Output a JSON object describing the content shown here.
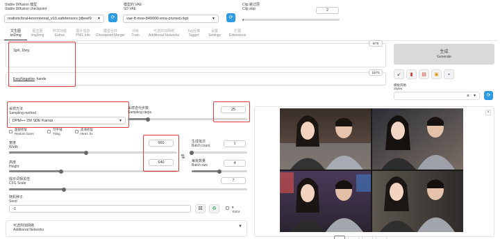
{
  "top": {
    "checkpoint_label_zh": "Stable Diffusion 模型",
    "checkpoint_label_en": "Stable Diffusion checkpoint",
    "checkpoint_value": "realistic/braHennmixreal_v10.safetensors [dbeef9",
    "vae_label_zh": "模型的 VAE",
    "vae_label_en": "SD VAE",
    "vae_value": "vae-ft-mse-840000-ema-pruned.ckpt",
    "clip_label_zh": "Clip 跳过层",
    "clip_label_en": "Clip skip",
    "clip_value": "2",
    "refresh_icon": "refresh-icon"
  },
  "tabs": [
    {
      "zh": "文生图",
      "en": "txt2img",
      "active": true
    },
    {
      "zh": "图生图",
      "en": "img2img"
    },
    {
      "zh": "附加功能",
      "en": "Extras"
    },
    {
      "zh": "图片信息",
      "en": "PNG Info"
    },
    {
      "zh": "模型合并",
      "en": "Checkpoint Merger"
    },
    {
      "zh": "训练",
      "en": "Train"
    },
    {
      "zh": "可选附加网络",
      "en": "Additional Networks"
    },
    {
      "zh": "Tag反推",
      "en": "Tagger"
    },
    {
      "zh": "设置",
      "en": "Settings"
    },
    {
      "zh": "扩展",
      "en": "Extensions"
    }
  ],
  "prompt": {
    "positive": "1girl, 1boy,",
    "positive_count": "6/75",
    "negative_prefix": "EasyNegative",
    "negative_suffix": ", hands",
    "negative_count": "10/75"
  },
  "generate": {
    "zh": "生成",
    "en": "Generate"
  },
  "styles": {
    "label_zh": "模板风格",
    "label_en": "Styles",
    "clear": "×"
  },
  "sampling": {
    "method_label_zh": "采样方法",
    "method_label_en": "Sampling method",
    "method_value": "DPM++ 2M SDE Karras",
    "steps_label_zh": "采样迭代步数",
    "steps_label_en": "Sampling steps",
    "steps_value": "25"
  },
  "options": [
    {
      "zh": "面部修复",
      "en": "Restore faces"
    },
    {
      "zh": "可平铺",
      "en": "Tiling"
    },
    {
      "zh": "高清修复",
      "en": "Hires. fix"
    }
  ],
  "size": {
    "width_zh": "宽度",
    "width_en": "Width",
    "width_value": "960",
    "height_zh": "高度",
    "height_en": "Height",
    "height_value": "640",
    "batch_count_zh": "生成批次",
    "batch_count_en": "Batch count",
    "batch_count_value": "1",
    "batch_size_zh": "每批数量",
    "batch_size_en": "Batch size",
    "batch_size_value": "4",
    "swap": "⇅"
  },
  "cfg": {
    "zh": "提示词相关性",
    "en": "CFG Scale",
    "value": "7"
  },
  "seed": {
    "zh": "随机种子",
    "en": "Seed",
    "value": "-1",
    "extra": "Extra"
  },
  "additional": {
    "zh": "可选附加网络",
    "en": "Additional Networks",
    "toggle": "▼"
  },
  "close": "×",
  "icons": [
    "arrow-icon",
    "trash-icon",
    "note-icon",
    "clipboard-icon",
    "save-icon",
    "dice-icon",
    "recycle-icon"
  ],
  "sliders": {
    "steps": 0.17,
    "width": 0.46,
    "height": 0.31,
    "batch_count": 0.0,
    "batch_size": 0.5,
    "cfg": 0.23
  },
  "colors": {
    "accent": "#2f9be3",
    "annotation": "#e23c3c"
  }
}
